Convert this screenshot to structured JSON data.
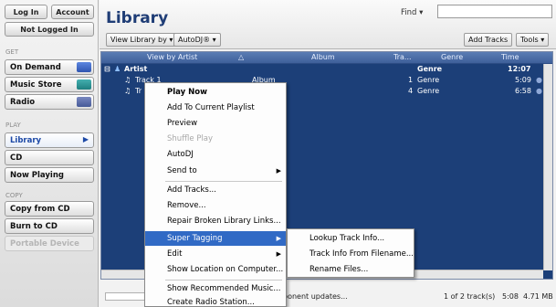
{
  "sidebar": {
    "login_label": "Log In",
    "account_label": "Account",
    "status_label": "Not Logged In",
    "get_label": "GET",
    "get_items": [
      "On Demand",
      "Music Store",
      "Radio"
    ],
    "play_label": "PLAY",
    "play_items": [
      "Library",
      "CD",
      "Now Playing"
    ],
    "copy_label": "COPY",
    "copy_items": [
      "Copy from CD",
      "Burn to CD",
      "Portable Device"
    ],
    "chip_colors": [
      "#3a63c8",
      "#1e8a8a",
      "#4a5ea0"
    ],
    "active_arrow": "▶"
  },
  "header": {
    "title": "Library",
    "find_label": "Find ▾",
    "find_value": "",
    "view_by": "View Library by ▾",
    "autodj": "AutoDJ® ▾",
    "add_tracks": "Add Tracks",
    "tools": "Tools ▾"
  },
  "grid": {
    "columns": [
      "View by Artist",
      "△",
      "Album",
      "Tra...",
      "Genre",
      "Time"
    ],
    "group": {
      "expander": "⊟",
      "artist": "Artist",
      "genre": "Genre",
      "time": "12:07"
    },
    "rows": [
      {
        "title": "Track 1",
        "album": "Album",
        "track": "1",
        "genre": "Genre",
        "time": "5:09"
      },
      {
        "title": "Tr",
        "album": "",
        "track": "4",
        "genre": "Genre",
        "time": "6:58"
      }
    ]
  },
  "status": {
    "left": "ponent updates...",
    "count": "1 of 2 track(s)",
    "duration": "5:08",
    "size": "4.71 MB"
  },
  "context_menu": {
    "items": [
      {
        "label": "Play Now",
        "style": "bold"
      },
      {
        "label": "Add To Current Playlist",
        "style": ""
      },
      {
        "label": "Preview",
        "style": ""
      },
      {
        "label": "Shuffle Play",
        "style": "disabled"
      },
      {
        "label": "AutoDJ",
        "style": ""
      },
      {
        "label": "Send to",
        "style": "",
        "submenu": true
      },
      {
        "label": "Add Tracks...",
        "style": ""
      },
      {
        "label": "Remove...",
        "style": ""
      },
      {
        "label": "Repair Broken Library Links...",
        "style": ""
      },
      {
        "label": "Super Tagging",
        "style": "hl",
        "submenu": true
      },
      {
        "label": "Edit",
        "style": "",
        "submenu": true
      },
      {
        "label": "Show Location on Computer...",
        "style": ""
      },
      {
        "label": "Show Recommended Music...",
        "style": ""
      },
      {
        "label": "Create Radio Station...",
        "style": ""
      }
    ],
    "arrow": "▶"
  },
  "sub_menu": {
    "items": [
      "Lookup Track Info...",
      "Track Info From Filename...",
      "Rename Files..."
    ]
  },
  "colors": {
    "grid_bg": "#1c3f78",
    "highlight": "#316ac5",
    "title": "#1f3d76"
  },
  "icons": {
    "artist": "person-icon",
    "track": "music-note-icon",
    "submenu": "chevron-right-icon"
  }
}
